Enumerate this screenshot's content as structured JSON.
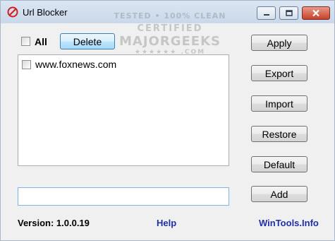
{
  "window": {
    "title": "Url Blocker",
    "icon": "no-entry-icon"
  },
  "toolbar": {
    "all_label": "All",
    "delete_label": "Delete"
  },
  "list": {
    "items": [
      {
        "label": "www.foxnews.com",
        "checked": false
      }
    ]
  },
  "side_buttons": {
    "apply": "Apply",
    "export": "Export",
    "import": "Import",
    "restore": "Restore",
    "default": "Default",
    "add": "Add"
  },
  "input": {
    "value": ""
  },
  "footer": {
    "version": "Version: 1.0.0.19",
    "help": "Help",
    "wintools": "WinTools.Info"
  },
  "watermark": {
    "line1": "TESTED • 100% CLEAN",
    "line2": "CERTIFIED",
    "line3": "MAJORGEEKS",
    "line4": "★★★★★★ .COM"
  },
  "colors": {
    "link": "#1f2fa8",
    "close_button": "#c7412a"
  }
}
